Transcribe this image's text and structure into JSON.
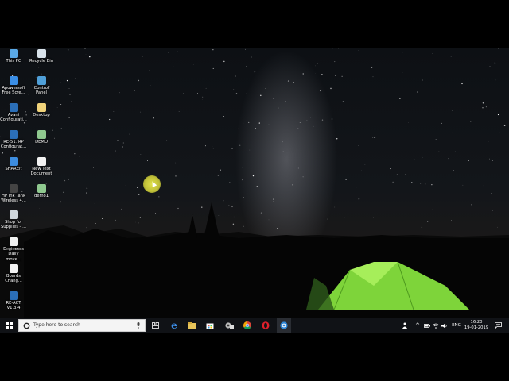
{
  "desktop": {
    "icons": [
      {
        "label": "This PC",
        "icon": "this-pc-icon",
        "color": "#5aa9e6"
      },
      {
        "label": "Recycle Bin",
        "icon": "recycle-bin-icon",
        "color": "#d8e2ea"
      },
      {
        "label": "Apowersoft\nFree Scre...",
        "icon": "apowersoft-icon",
        "color": "#3a8ee6"
      },
      {
        "label": "Control\nPanel",
        "icon": "control-panel-icon",
        "color": "#4f9fd8"
      },
      {
        "label": "Avani\nConfigurati...",
        "icon": "avani-config-icon",
        "color": "#2b6fb8"
      },
      {
        "label": "Desktop",
        "icon": "desktop-folder-icon",
        "color": "#f0d37a"
      },
      {
        "label": "RE-517RP\nConfigurat...",
        "icon": "re517rp-config-icon",
        "color": "#2b6fb8"
      },
      {
        "label": "DEMO",
        "icon": "demo-file-icon",
        "color": "#8fc98f"
      },
      {
        "label": "SHAREit",
        "icon": "shareit-icon",
        "color": "#3d8de0"
      },
      {
        "label": "New Text\nDocument",
        "icon": "text-document-icon",
        "color": "#f2f2f2"
      },
      {
        "label": "HP Ink Tank\nWireless 4...",
        "icon": "hp-printer-icon",
        "color": "#444444"
      },
      {
        "label": "demo1",
        "icon": "demo1-file-icon",
        "color": "#8fc98f"
      },
      {
        "label": "Shop for\nSupplies - ...",
        "icon": "shop-supplies-icon",
        "color": "#cfd6dc"
      },
      {
        "label": "Engineers\nDaily move...",
        "icon": "engineers-doc-icon",
        "color": "#f2f2f2"
      },
      {
        "label": "Boards\nChang...",
        "icon": "boards-doc-icon",
        "color": "#f2f2f2"
      },
      {
        "label": "RE-ACT\nV1.3.4",
        "icon": "re-act-icon",
        "color": "#2b6fb8"
      }
    ]
  },
  "taskbar": {
    "start_icon": "windows-start-icon",
    "search_placeholder": "Type here to search",
    "pinned": [
      {
        "icon": "task-view-icon"
      },
      {
        "icon": "edge-icon"
      },
      {
        "icon": "file-explorer-icon"
      },
      {
        "icon": "store-icon"
      },
      {
        "icon": "settings-app-icon"
      },
      {
        "icon": "chrome-icon"
      },
      {
        "icon": "opera-icon"
      },
      {
        "icon": "blue-app-icon"
      }
    ],
    "tray": {
      "language": "ENG",
      "time": "16:20",
      "date": "19-01-2019"
    }
  },
  "colors": {
    "taskbar_bg": "#101216",
    "accent": "#5fa8e8",
    "tent": "#7ed43a"
  }
}
